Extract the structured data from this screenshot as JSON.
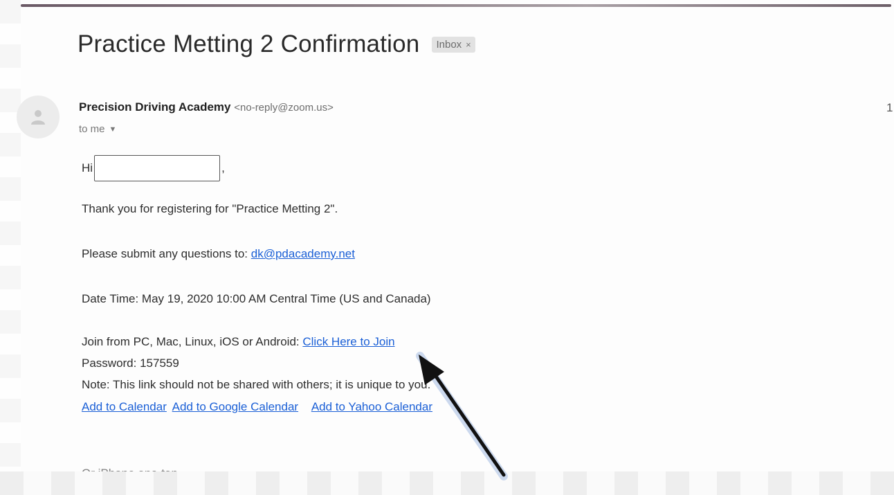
{
  "subject": "Practice Metting 2 Confirmation",
  "label": {
    "name": "Inbox",
    "close": "×"
  },
  "sender": {
    "name": "Precision Driving Academy",
    "email": "<no-reply@zoom.us>",
    "recipient": "to me"
  },
  "right_edge_fragment": "1",
  "body": {
    "greeting": "Hi",
    "greeting_comma": ",",
    "thanks": "Thank you for registering for \"Practice Metting 2\".",
    "questions_prefix": "Please submit any questions to:",
    "questions_email": "dk@pdacademy.net",
    "datetime": "Date Time: May 19, 2020 10:00 AM Central Time (US and Canada)",
    "join_prefix": "Join from PC, Mac, Linux, iOS or Android:",
    "join_link": "Click Here to Join",
    "password": "Password: 157559",
    "note": "Note: This link should not be shared with others; it is unique to you.",
    "calendar_links": [
      "Add to Calendar",
      "Add to Google Calendar",
      "Add to Yahoo Calendar"
    ],
    "iphone_fragment": "Or iPhone one-tap"
  },
  "colors": {
    "link": "#1a5fd6",
    "arrow": "#111111"
  },
  "icons": {
    "avatar": "person-icon",
    "recipient_caret": "caret-down-icon",
    "label_close": "close-icon"
  }
}
